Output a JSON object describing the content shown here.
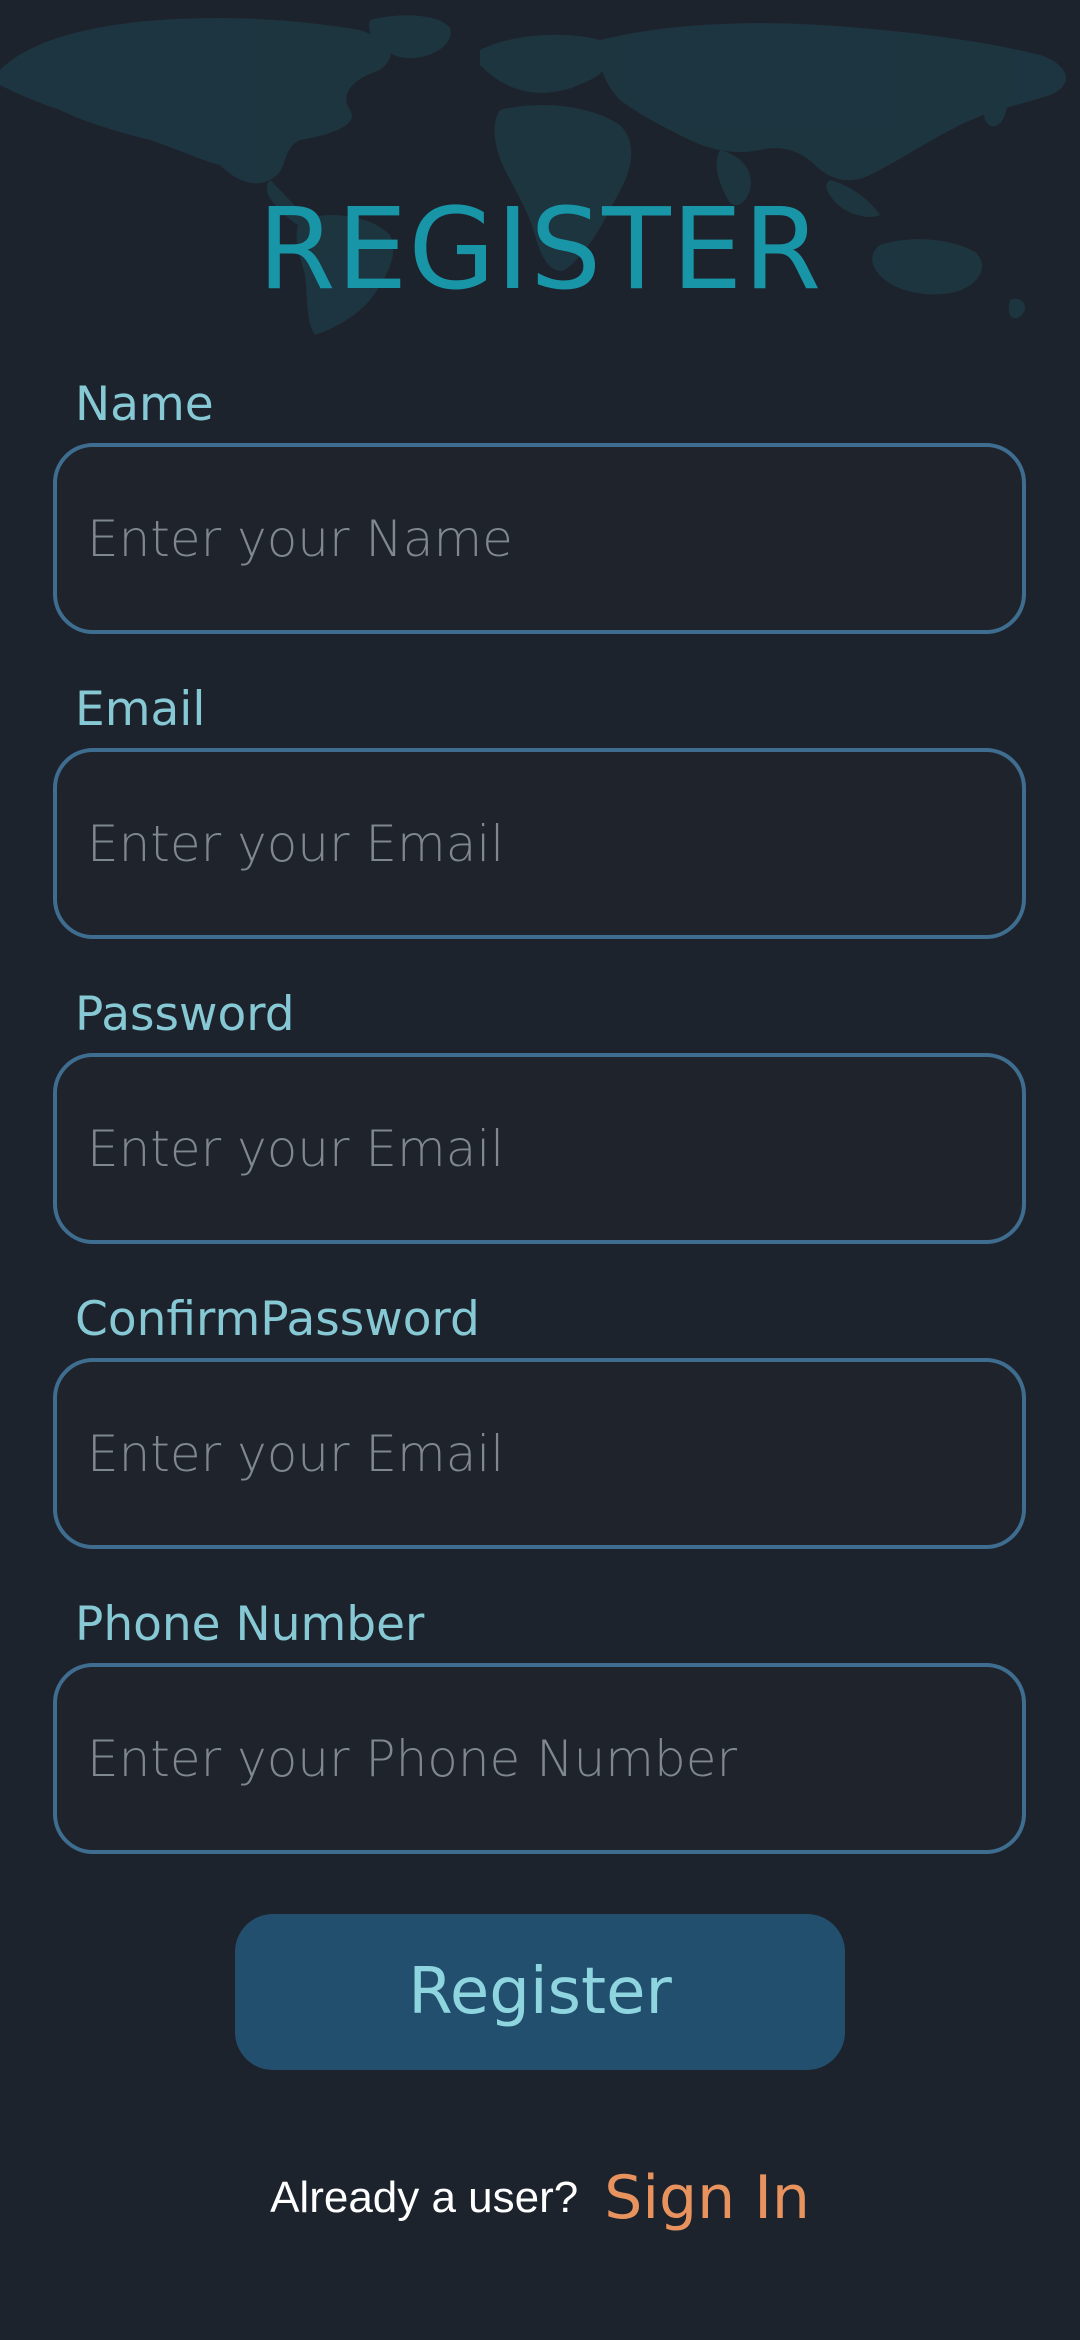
{
  "header": {
    "title": "REGISTER"
  },
  "form": {
    "fields": [
      {
        "label": "Name",
        "placeholder": "Enter your Name",
        "value": ""
      },
      {
        "label": "Email",
        "placeholder": "Enter your Email",
        "value": ""
      },
      {
        "label": "Password",
        "placeholder": "Enter your Email",
        "value": ""
      },
      {
        "label": "ConfirmPassword",
        "placeholder": "Enter your Email",
        "value": ""
      },
      {
        "label": "Phone Number",
        "placeholder": "Enter your Phone Number",
        "value": ""
      }
    ],
    "submit_label": "Register"
  },
  "footer": {
    "prompt": "Already a user?",
    "link_label": "Sign In"
  },
  "theme": {
    "background": "#1d232d",
    "title_color": "#1896a8",
    "label_color": "#86c9d4",
    "field_border": "#3f6d90",
    "button_bg": "#234f6e",
    "button_text": "#8ed5df",
    "link_color": "#e8935e"
  },
  "icons": {
    "background_decoration": "world-map"
  }
}
